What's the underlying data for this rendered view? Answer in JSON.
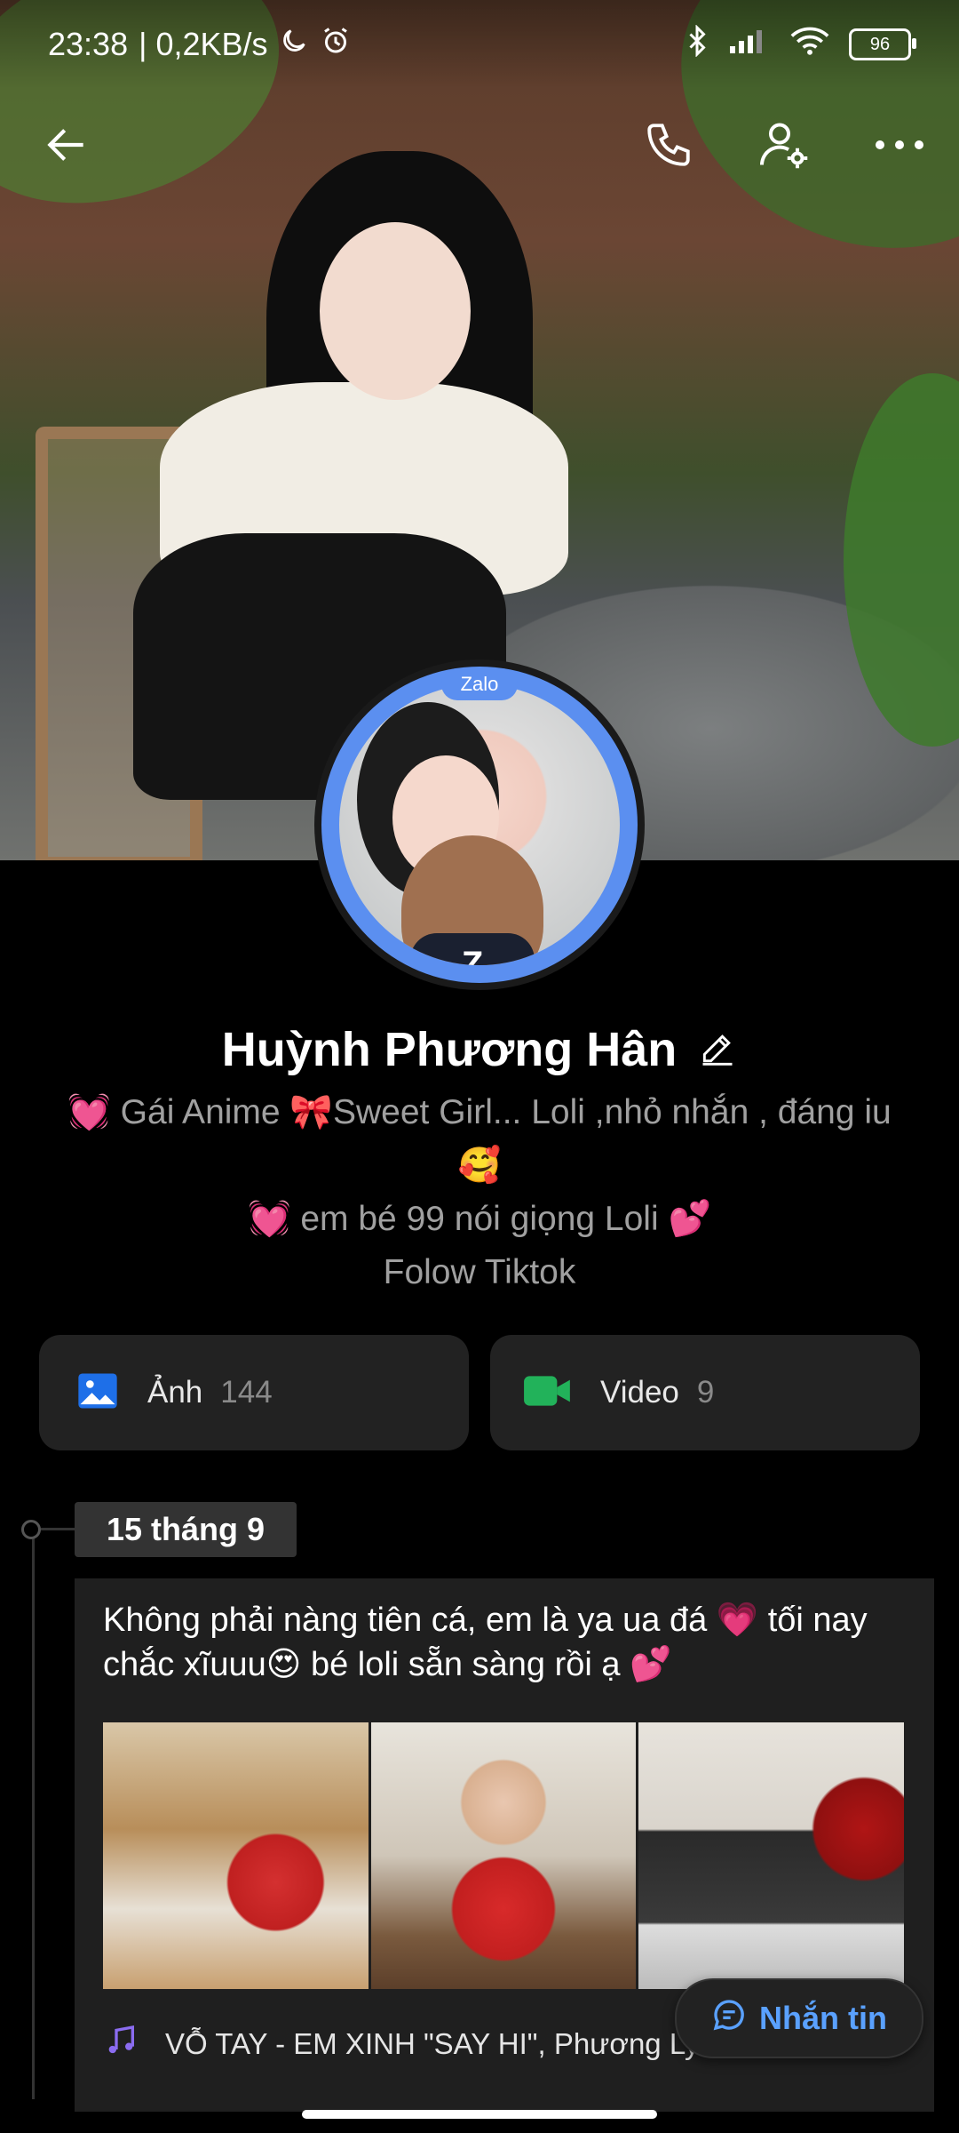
{
  "status_bar": {
    "time": "23:38",
    "network_speed": "| 0,2KB/s",
    "battery": "96"
  },
  "toolbar": {
    "back_icon": "arrow-left-icon",
    "call_icon": "phone-icon",
    "profile_settings_icon": "user-gear-icon",
    "more_icon": "more-horizontal-icon"
  },
  "profile": {
    "badge": "Zalo",
    "name": "Huỳnh Phương Hân",
    "bio_line1": "💓 Gái Anime 🎀Sweet Girl... Loli ,nhỏ nhắn , đáng iu",
    "bio_line2": "🥰",
    "bio_line3": "💓 em bé 99 nói giọng Loli 💕",
    "bio_line4": "Folow Tiktok"
  },
  "media": {
    "photos_label": "Ảnh",
    "photos_count": "144",
    "videos_label": "Video",
    "videos_count": "9"
  },
  "timeline": {
    "date": "15 tháng 9",
    "post_text": "Không phải nàng tiên cá, em là ya ua đá 💗 tối nay chắc xĩuuu😍 bé loli sẵn sàng rồi ạ 💕",
    "music": "VỖ TAY - EM XINH \"SAY HI\", Phương Ly"
  },
  "actions": {
    "message_button": "Nhắn tin"
  },
  "colors": {
    "accent": "#5aa1ff",
    "avatar_ring": "#5b8ff0",
    "card_bg": "#222222"
  }
}
